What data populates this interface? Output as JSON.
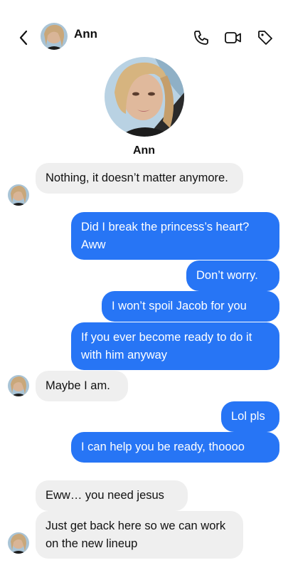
{
  "header": {
    "contact_name": "Ann",
    "icons": [
      "back-chevron-icon",
      "phone-icon",
      "video-camera-icon",
      "tag-icon"
    ]
  },
  "profile": {
    "name": "Ann"
  },
  "colors": {
    "outgoing_bubble": "#2775f5",
    "incoming_bubble": "#efefef"
  },
  "messages": [
    {
      "direction": "in",
      "text": "Nothing, it doesn’t matter anymore."
    },
    {
      "direction": "out",
      "text": "Did I break the princess’s heart? Aww"
    },
    {
      "direction": "out",
      "text": "Don’t worry."
    },
    {
      "direction": "out",
      "text": "I won’t spoil Jacob for you"
    },
    {
      "direction": "out",
      "text": "If you ever become ready to do it with him anyway"
    },
    {
      "direction": "in",
      "text": "Maybe I am."
    },
    {
      "direction": "out",
      "text": "Lol pls"
    },
    {
      "direction": "out",
      "text": "I can help you be ready, thoooo"
    },
    {
      "direction": "in",
      "text": "Eww… you need jesus"
    },
    {
      "direction": "in",
      "text": "Just get back here so we can work on the new lineup"
    }
  ]
}
